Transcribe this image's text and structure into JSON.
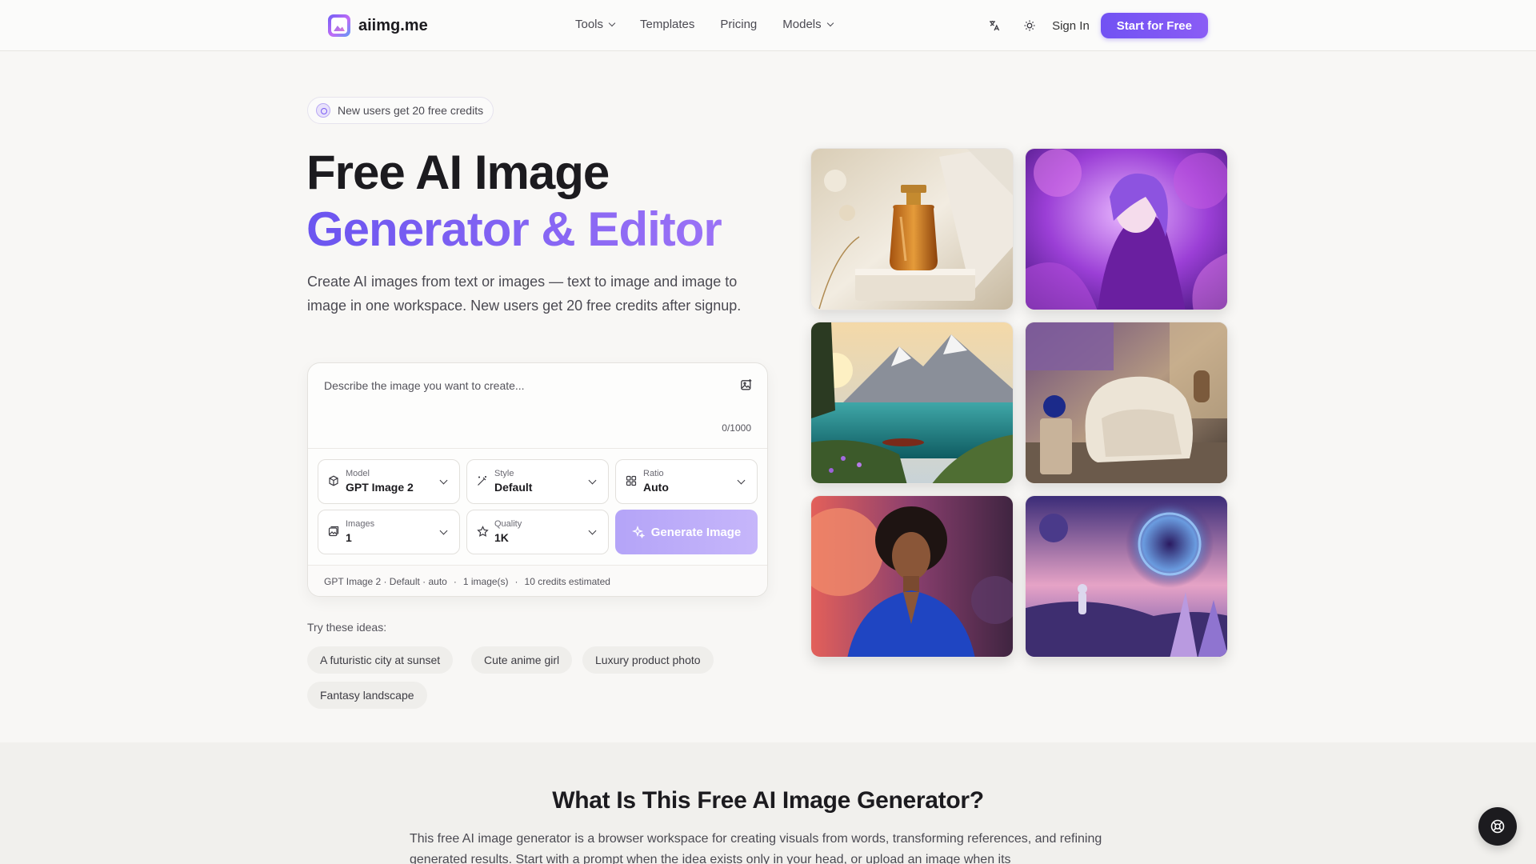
{
  "header": {
    "logo_text": "aiimg.me",
    "nav": [
      {
        "label": "Tools",
        "has_dropdown": true
      },
      {
        "label": "Templates",
        "has_dropdown": false
      },
      {
        "label": "Pricing",
        "has_dropdown": false
      },
      {
        "label": "Models",
        "has_dropdown": true
      }
    ],
    "translate_icon": "translate-icon",
    "theme_icon": "sun-icon",
    "sign_in": "Sign In",
    "cta": "Start for Free"
  },
  "hero": {
    "badge": "New users get 20 free credits",
    "title_line1": "Free AI Image",
    "title_line2": "Generator & Editor",
    "description": "Create AI images from text or images — text to image and image to image in one workspace. New users get 20 free credits after signup."
  },
  "generator": {
    "prompt_placeholder": "Describe the image you want to create...",
    "char_counter": "0/1000",
    "model": {
      "label": "Model",
      "value": "GPT Image 2"
    },
    "style": {
      "label": "Style",
      "value": "Default"
    },
    "ratio": {
      "label": "Ratio",
      "value": "Auto"
    },
    "images": {
      "label": "Images",
      "value": "1"
    },
    "quality": {
      "label": "Quality",
      "value": "1K"
    },
    "generate_button": "Generate Image",
    "summary": {
      "settings": "GPT Image 2 · Default · auto",
      "count": "1 image(s)",
      "credits": "10 credits estimated",
      "separator": "·"
    }
  },
  "ideas": {
    "title": "Try these ideas:",
    "chips": [
      "A futuristic city at sunset",
      "Cute anime girl",
      "Luxury product photo",
      "Fantasy landscape"
    ]
  },
  "gallery": [
    {
      "name": "perfume-bottle-image"
    },
    {
      "name": "anime-girl-image"
    },
    {
      "name": "mountain-lake-image"
    },
    {
      "name": "armchair-interior-image"
    },
    {
      "name": "portrait-woman-image"
    },
    {
      "name": "space-astronaut-image"
    }
  ],
  "section2": {
    "title": "What Is This Free AI Image Generator?",
    "text": "This free AI image generator is a browser workspace for creating visuals from words, transforming references, and refining generated results. Start with a prompt when the idea exists only in your head, or upload an image when its"
  },
  "colors": {
    "accent": "#7152f3",
    "accent_light": "#9b72f6",
    "generate_disabled": "#b4a4f8"
  }
}
